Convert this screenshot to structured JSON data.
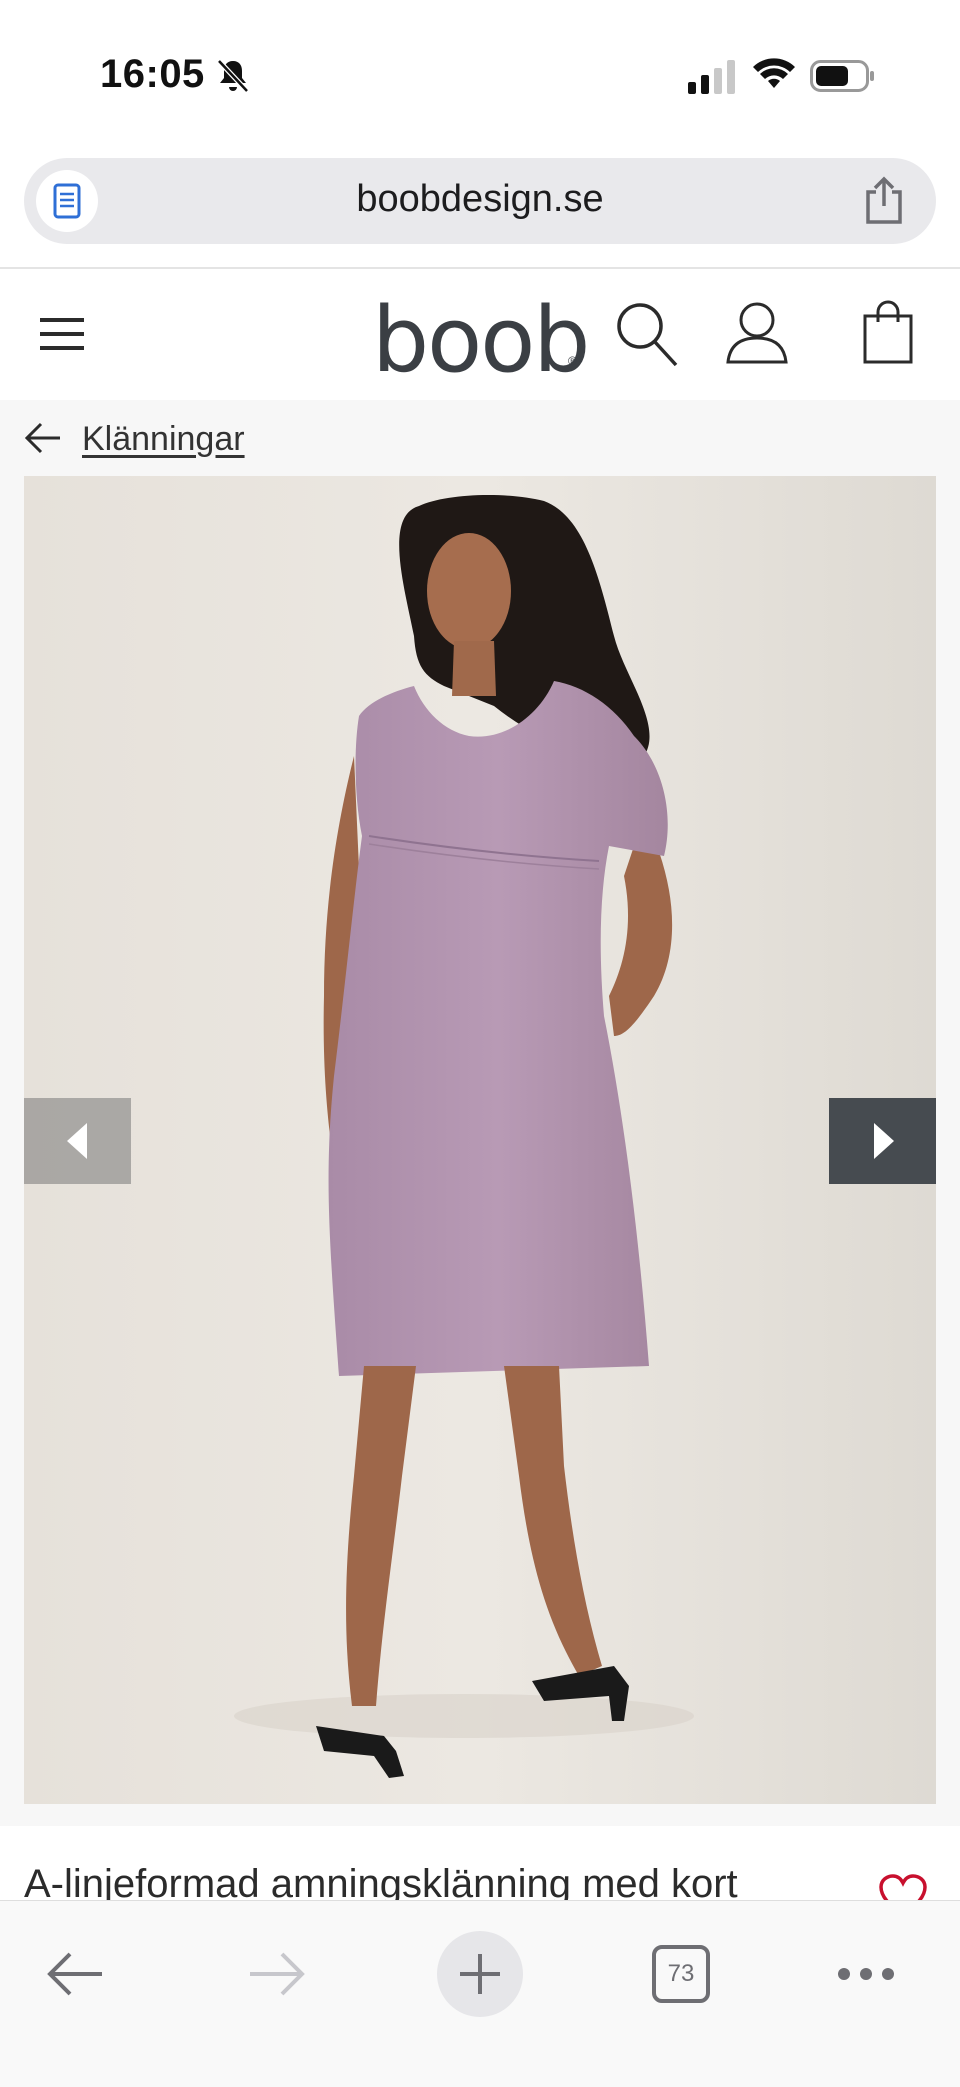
{
  "status_bar": {
    "time": "16:05",
    "icons": [
      "bell-slash-icon",
      "signal-icon",
      "wifi-icon",
      "battery-icon"
    ]
  },
  "browser": {
    "url": "boobdesign.se",
    "tab_count": "73",
    "icons": [
      "reader-icon",
      "share-icon",
      "back-arrow-icon",
      "forward-arrow-icon",
      "plus-icon",
      "tabs-icon",
      "more-icon"
    ]
  },
  "header": {
    "logo_text": "boob",
    "logo_reg": "®",
    "icons": [
      "hamburger-menu-icon",
      "search-icon",
      "account-icon",
      "shopping-bag-icon"
    ]
  },
  "breadcrumb": {
    "label": "Klänningar"
  },
  "product": {
    "title": "A-linjeformad amningsklänning med kort",
    "image_description": "product-photo",
    "dress_color": "#b89ab5",
    "gallery_icons": [
      "chevron-left-icon",
      "chevron-right-icon"
    ],
    "wishlist_icon": "heart-icon",
    "accent_color": "#c8102e"
  }
}
